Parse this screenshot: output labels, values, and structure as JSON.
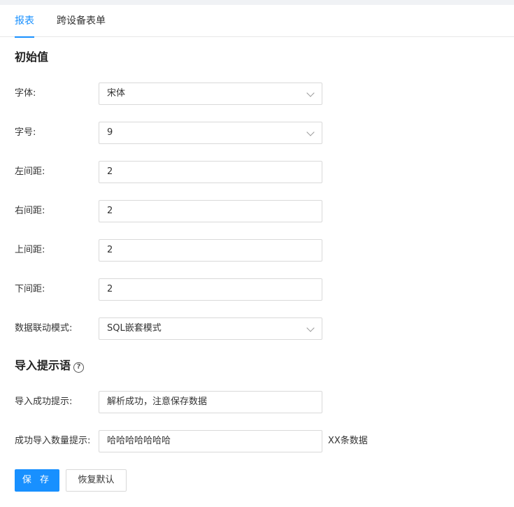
{
  "tabs": [
    {
      "label": "报表",
      "active": true
    },
    {
      "label": "跨设备表单",
      "active": false
    }
  ],
  "section_initial": {
    "title": "初始值",
    "fields": [
      {
        "label": "字体:",
        "value": "宋体",
        "type": "select"
      },
      {
        "label": "字号:",
        "value": "9",
        "type": "select"
      },
      {
        "label": "左间距:",
        "value": "2",
        "type": "input"
      },
      {
        "label": "右间距:",
        "value": "2",
        "type": "input"
      },
      {
        "label": "上间距:",
        "value": "2",
        "type": "input"
      },
      {
        "label": "下间距:",
        "value": "2",
        "type": "input"
      },
      {
        "label": "数据联动模式:",
        "value": "SQL嵌套模式",
        "type": "select"
      }
    ]
  },
  "section_import": {
    "title": "导入提示语",
    "help_icon": "question-circle-icon",
    "fields": [
      {
        "label": "导入成功提示:",
        "value": "解析成功，注意保存数据"
      },
      {
        "label": "成功导入数量提示:",
        "value": "哈哈哈哈哈哈哈",
        "suffix": "XX条数据"
      }
    ]
  },
  "buttons": {
    "save": "保 存",
    "reset": "恢复默认"
  },
  "colors": {
    "accent": "#1890ff",
    "border": "#d9d9d9"
  }
}
